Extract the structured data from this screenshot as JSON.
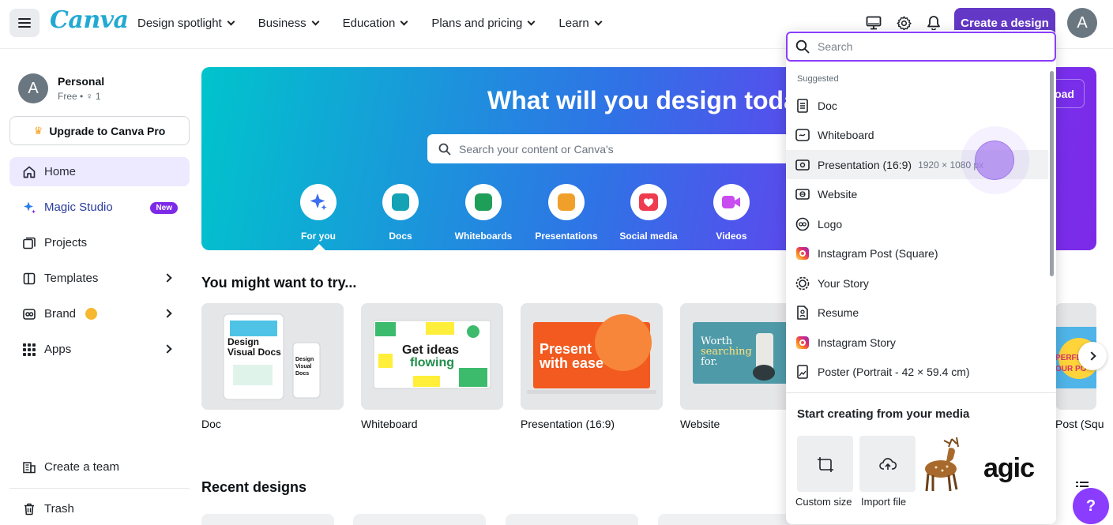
{
  "topbar": {
    "logo": "Canva",
    "nav": [
      {
        "label": "Design spotlight"
      },
      {
        "label": "Business"
      },
      {
        "label": "Education"
      },
      {
        "label": "Plans and pricing"
      },
      {
        "label": "Learn"
      }
    ],
    "create_button": "Create a design",
    "avatar_initial": "A",
    "icons": [
      "desktop-icon",
      "gear-icon",
      "bell-icon"
    ]
  },
  "sidebar": {
    "account": {
      "initial": "A",
      "name": "Personal",
      "plan": "Free • ♀ 1"
    },
    "upgrade": "Upgrade to Canva Pro",
    "items": [
      {
        "label": "Home",
        "icon": "home-icon",
        "active": true
      },
      {
        "label": "Magic Studio",
        "icon": "sparkle-icon",
        "badge": "New"
      },
      {
        "label": "Projects",
        "icon": "folder-icon"
      },
      {
        "label": "Templates",
        "icon": "template-icon"
      },
      {
        "label": "Brand",
        "icon": "brand-icon"
      },
      {
        "label": "Apps",
        "icon": "apps-icon"
      }
    ],
    "bottom": [
      {
        "label": "Create a team",
        "icon": "team-icon"
      },
      {
        "label": "Trash",
        "icon": "trash-icon"
      }
    ]
  },
  "hero": {
    "title": "What will you design today?",
    "search_placeholder": "Search your content or Canva's",
    "upload_label": "Upload",
    "categories": [
      {
        "label": "For you",
        "color": "#3b6ff0"
      },
      {
        "label": "Docs",
        "color": "#13a3b5"
      },
      {
        "label": "Whiteboards",
        "color": "#1f9e5a"
      },
      {
        "label": "Presentations",
        "color": "#f0a02a"
      },
      {
        "label": "Social media",
        "color": "#ef3b4f"
      },
      {
        "label": "Videos",
        "color": "#c84cf0"
      }
    ]
  },
  "try": {
    "title": "You might want to try...",
    "cards": [
      {
        "label": "Doc",
        "art": "Design Visual Docs"
      },
      {
        "label": "Whiteboard",
        "art": "Get ideas flowing"
      },
      {
        "label": "Presentation (16:9)",
        "art": "Present with ease"
      },
      {
        "label": "Website",
        "art": "Worth searching for."
      },
      {
        "label": "Post (Squ",
        "art": "PERFE OUR PO"
      }
    ]
  },
  "recent": {
    "title": "Recent designs"
  },
  "dropdown": {
    "search_placeholder": "Search",
    "suggested_label": "Suggested",
    "items": [
      {
        "label": "Doc",
        "icon": "doc-icon"
      },
      {
        "label": "Whiteboard",
        "icon": "whiteboard-icon"
      },
      {
        "label": "Presentation (16:9)",
        "icon": "presentation-icon",
        "dims": "1920 × 1080 px",
        "hover": true
      },
      {
        "label": "Website",
        "icon": "website-icon"
      },
      {
        "label": "Logo",
        "icon": "logo-icon"
      },
      {
        "label": "Instagram Post (Square)",
        "icon": "instagram-icon"
      },
      {
        "label": "Your Story",
        "icon": "story-icon"
      },
      {
        "label": "Resume",
        "icon": "resume-icon"
      },
      {
        "label": "Instagram Story",
        "icon": "instagram-icon"
      },
      {
        "label": "Poster (Portrait - 42 × 59.4 cm)",
        "icon": "poster-icon"
      }
    ],
    "media_title": "Start creating from your media",
    "media": [
      {
        "label": "Custom size",
        "icon": "custom-size-icon"
      },
      {
        "label": "Import file",
        "icon": "cloud-upload-icon"
      }
    ],
    "media_thumb_text": "agic"
  },
  "help_label": "?"
}
